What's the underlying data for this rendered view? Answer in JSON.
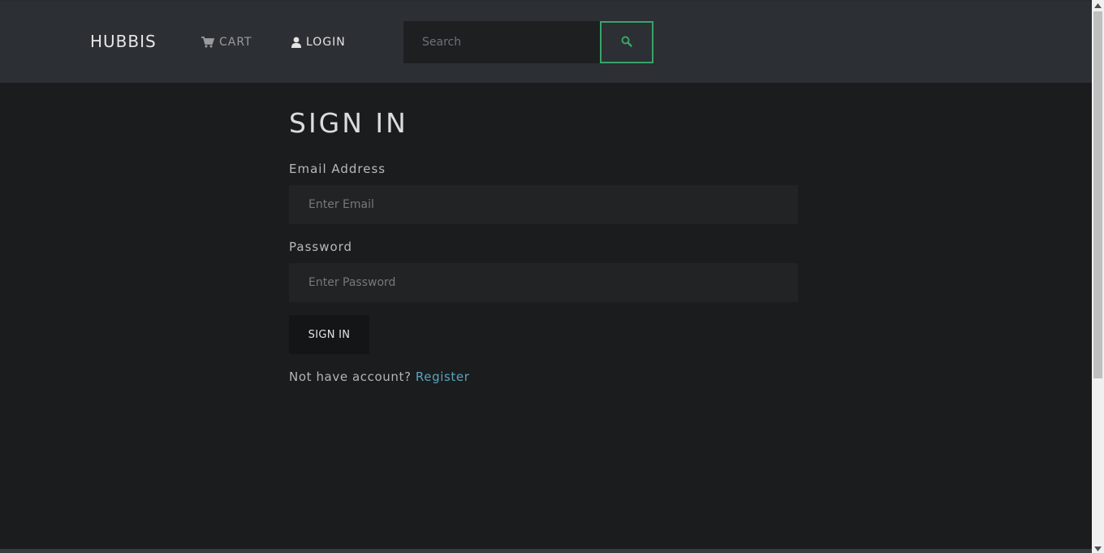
{
  "navbar": {
    "brand": "HUBBIS",
    "cart_label": "CART",
    "login_label": "LOGIN",
    "search_placeholder": "Search",
    "search_button_icon": "search-icon",
    "cart_icon": "shopping-cart-icon",
    "login_icon": "user-icon"
  },
  "form": {
    "title": "SIGN IN",
    "email_label": "Email Address",
    "email_placeholder": "Enter Email",
    "password_label": "Password",
    "password_placeholder": "Enter Password",
    "submit_label": "SIGN IN",
    "register_prompt": "Not have account?",
    "register_link": "Register"
  },
  "colors": {
    "background": "#1b1c1e",
    "navbar": "#2c2f33",
    "accent_green": "#3aa36a",
    "link_blue": "#5aa4be"
  }
}
